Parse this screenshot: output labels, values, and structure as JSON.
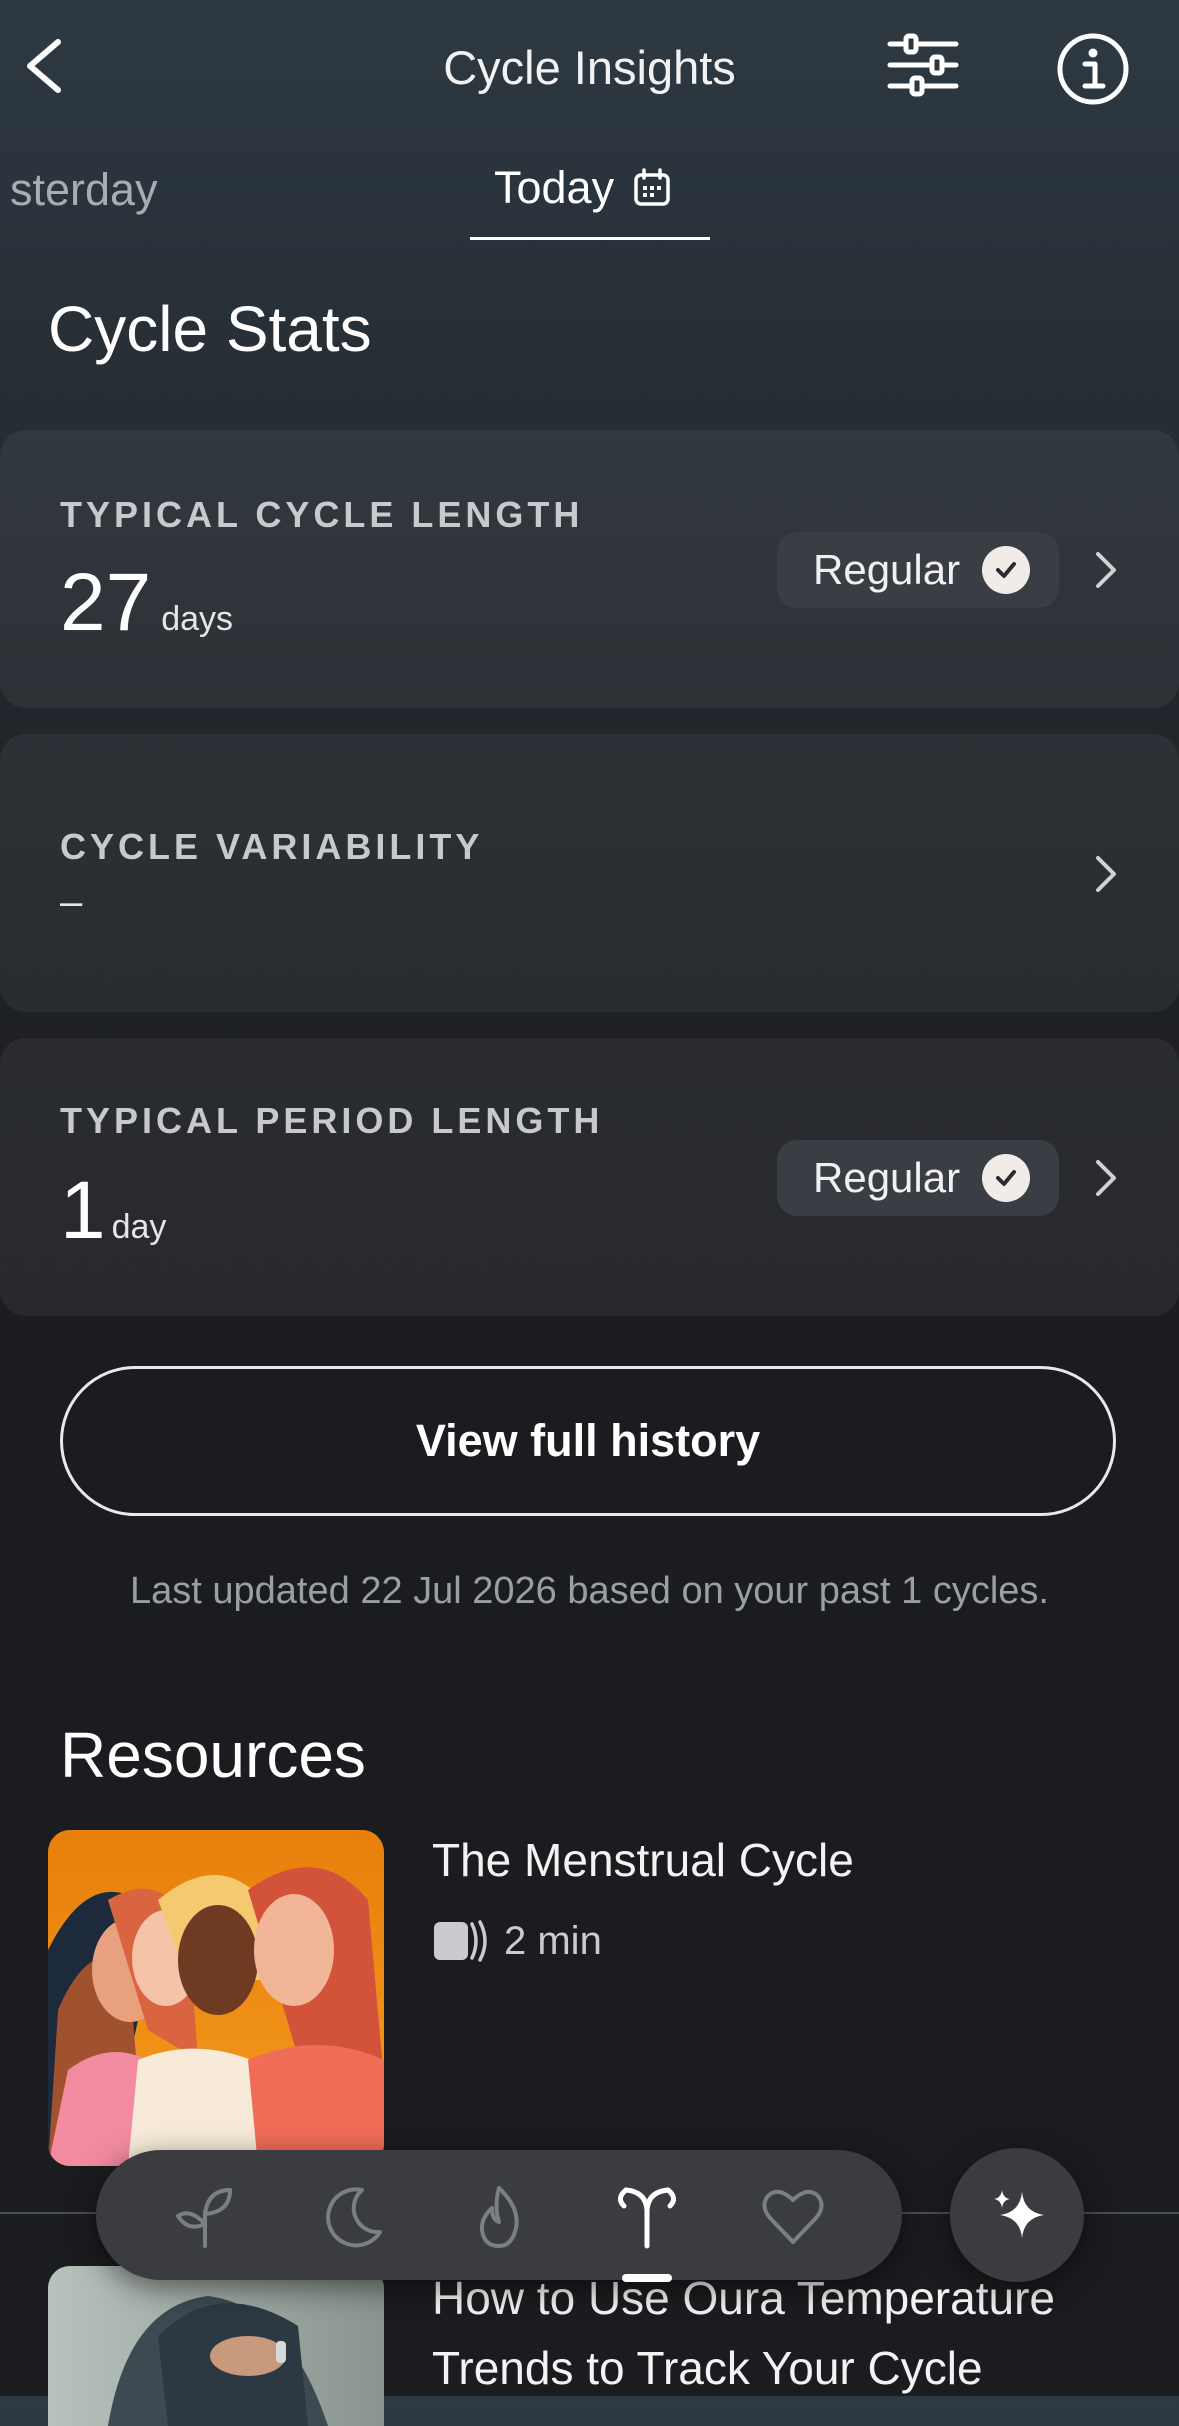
{
  "header": {
    "title": "Cycle Insights",
    "back_icon": "chevron-left-icon",
    "settings_icon": "sliders-icon",
    "info_icon": "info-icon"
  },
  "tabs": [
    {
      "label": "sterday"
    },
    {
      "label": "Today",
      "active": true,
      "icon": "calendar-icon"
    }
  ],
  "section_title": "Cycle Stats",
  "cards": [
    {
      "label": "TYPICAL CYCLE LENGTH",
      "value": "27",
      "unit": "days",
      "badge": "Regular"
    },
    {
      "label": "CYCLE VARIABILITY",
      "value": "–"
    },
    {
      "label": "TYPICAL PERIOD LENGTH",
      "value": "1",
      "unit": "day",
      "badge": "Regular"
    }
  ],
  "history_button": "View full history",
  "last_updated": "Last updated 22 Jul 2026 based on your past 1 cycles.",
  "resources": {
    "title": "Resources",
    "items": [
      {
        "title": "The Menstrual Cycle",
        "duration": "2 min"
      },
      {
        "title_line1": "How to Use Oura Temperature",
        "title_line2": "Trends to Track Your Cycle"
      }
    ]
  },
  "bottom_nav": [
    {
      "name": "sprout-icon"
    },
    {
      "name": "moon-icon"
    },
    {
      "name": "flame-icon"
    },
    {
      "name": "cycle-icon",
      "active": true
    },
    {
      "name": "heart-icon"
    }
  ],
  "fab_icon": "sparkle-icon",
  "colors": {
    "background": "#1b1c1f",
    "card": "#2a2d31",
    "badge": "#3a3e44",
    "accent": "#ffffff"
  }
}
